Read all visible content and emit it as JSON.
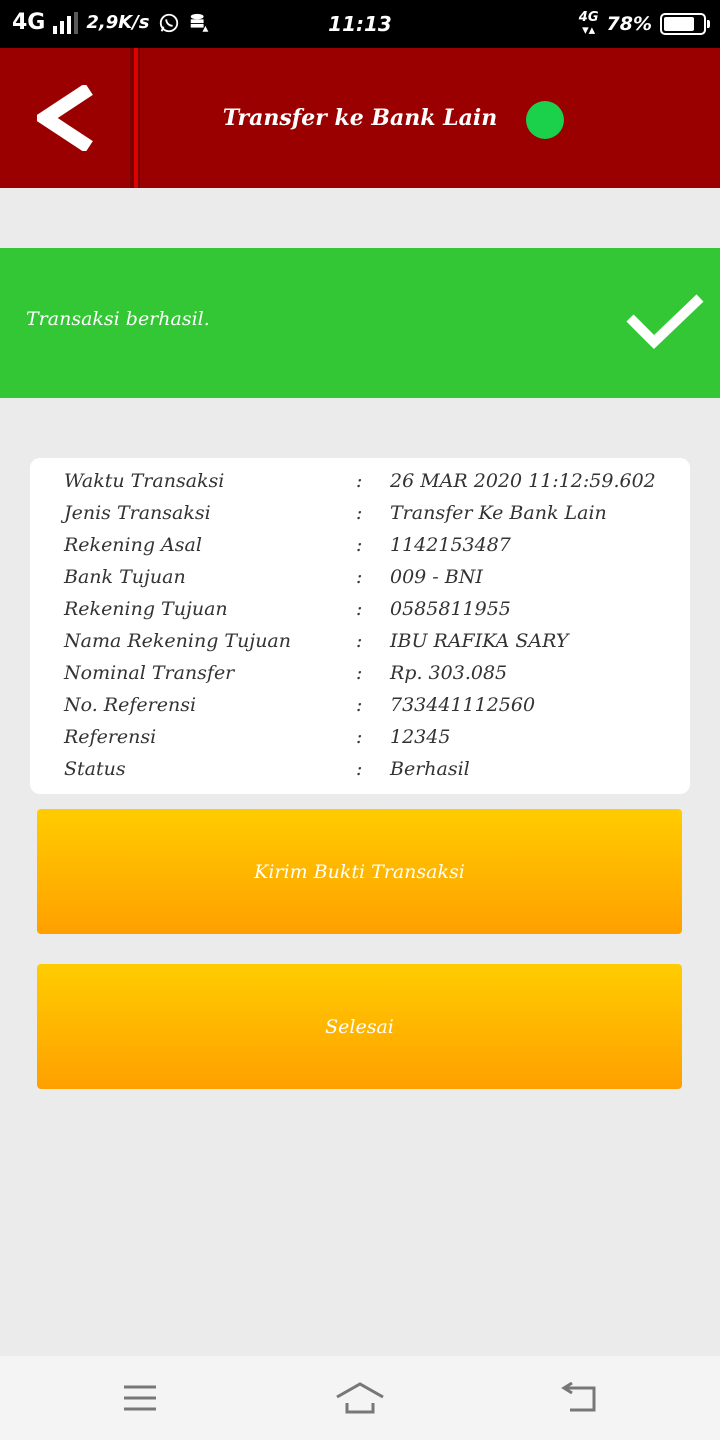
{
  "status_bar": {
    "network": "4G",
    "speed": "2,9K/s",
    "time": "11:13",
    "network_right": "4G",
    "battery": "78%",
    "battery_level": 0.78
  },
  "header": {
    "title": "Transfer ke Bank Lain",
    "online_color": "#1bd04b"
  },
  "banner": {
    "message": "Transaksi berhasil."
  },
  "details": [
    {
      "label": "Waktu Transaksi",
      "value": "26 MAR 2020 11:12:59.602"
    },
    {
      "label": "Jenis Transaksi",
      "value": "Transfer Ke Bank Lain"
    },
    {
      "label": "Rekening Asal",
      "value": "1142153487"
    },
    {
      "label": "Bank Tujuan",
      "value": "009 - BNI"
    },
    {
      "label": "Rekening Tujuan",
      "value": "0585811955"
    },
    {
      "label": "Nama Rekening Tujuan",
      "value": "IBU RAFIKA SARY"
    },
    {
      "label": "Nominal Transfer",
      "value": "Rp. 303.085"
    },
    {
      "label": "No. Referensi",
      "value": "733441112560"
    },
    {
      "label": "Referensi",
      "value": "12345"
    },
    {
      "label": "Status",
      "value": "Berhasil"
    }
  ],
  "colon": ":",
  "buttons": {
    "send_proof": "Kirim Bukti Transaksi",
    "done": "Selesai"
  },
  "colors": {
    "header": "#9a0000",
    "banner": "#33c736",
    "button_top": "#ffcc00",
    "button_bottom": "#ffa000"
  }
}
